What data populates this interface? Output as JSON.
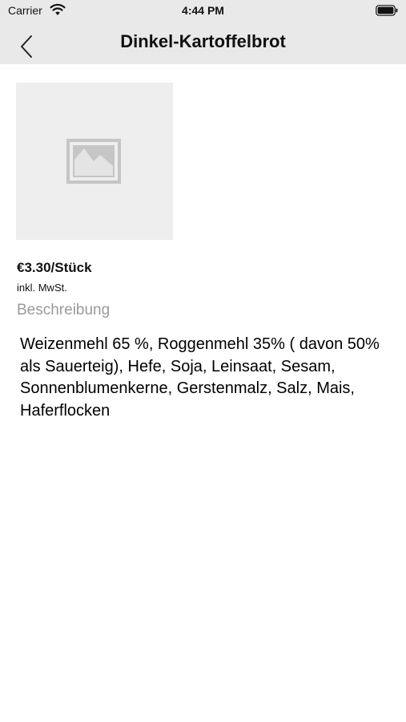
{
  "status_bar": {
    "carrier": "Carrier",
    "time": "4:44 PM",
    "icons": [
      "wifi-icon",
      "battery-icon"
    ]
  },
  "nav_bar": {
    "back_icon": "chevron-left-icon",
    "title": "Dinkel-Kartoffelbrot"
  },
  "product": {
    "image_icon": "image-placeholder-icon",
    "price": "€3.30/Stück",
    "tax_note": "inkl. MwSt.",
    "section_title": "Beschreibung",
    "description": "Weizenmehl 65 %, Roggenmehl 35% ( davon 50% als Sauerteig), Hefe, Soja, Leinsaat, Sesam, Sonnenblumenkerne, Gerstenmalz, Salz, Mais, Haferflocken"
  },
  "colors": {
    "header_background": "#e9e9e9",
    "image_background": "#efeeee",
    "section_title": "#9a9a9a"
  }
}
